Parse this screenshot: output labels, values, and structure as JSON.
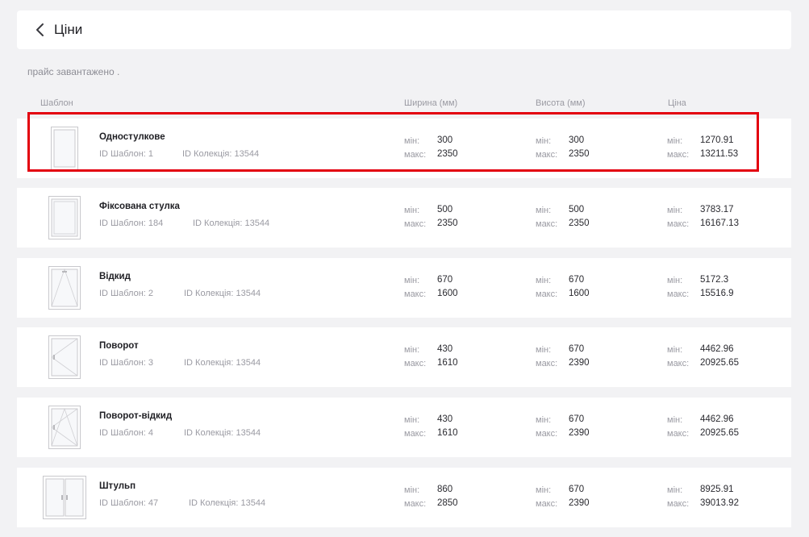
{
  "header": {
    "title": "Ціни"
  },
  "status_text": "прайс завантажено .",
  "columns": {
    "template": "Шаблон",
    "width": "Ширина (мм)",
    "height": "Висота (мм)",
    "price": "Ціна"
  },
  "labels": {
    "min": "мін:",
    "max": "макс:"
  },
  "rows": [
    {
      "name": "Одностулкове",
      "template_id": "ID Шаблон: 1",
      "collection_id": "ID Колекція: 13544",
      "width_min": "300",
      "width_max": "2350",
      "height_min": "300",
      "height_max": "2350",
      "price_min": "1270.91",
      "price_max": "13211.53",
      "icon": "single-sash-window-icon"
    },
    {
      "name": "Фіксована стулка",
      "template_id": "ID Шаблон: 184",
      "collection_id": "ID Колекція: 13544",
      "width_min": "500",
      "width_max": "2350",
      "height_min": "500",
      "height_max": "2350",
      "price_min": "3783.17",
      "price_max": "16167.13",
      "icon": "fixed-sash-window-icon"
    },
    {
      "name": "Відкид",
      "template_id": "ID Шаблон: 2",
      "collection_id": "ID Колекція: 13544",
      "width_min": "670",
      "width_max": "1600",
      "height_min": "670",
      "height_max": "1600",
      "price_min": "5172.3",
      "price_max": "15516.9",
      "icon": "tilt-window-icon"
    },
    {
      "name": "Поворот",
      "template_id": "ID Шаблон: 3",
      "collection_id": "ID Колекція: 13544",
      "width_min": "430",
      "width_max": "1610",
      "height_min": "670",
      "height_max": "2390",
      "price_min": "4462.96",
      "price_max": "20925.65",
      "icon": "turn-window-icon"
    },
    {
      "name": "Поворот-відкид",
      "template_id": "ID Шаблон: 4",
      "collection_id": "ID Колекція: 13544",
      "width_min": "430",
      "width_max": "1610",
      "height_min": "670",
      "height_max": "2390",
      "price_min": "4462.96",
      "price_max": "20925.65",
      "icon": "tilt-turn-window-icon"
    },
    {
      "name": "Штульп",
      "template_id": "ID Шаблон: 47",
      "collection_id": "ID Колекція: 13544",
      "width_min": "860",
      "width_max": "2850",
      "height_min": "670",
      "height_max": "2390",
      "price_min": "8925.91",
      "price_max": "39013.92",
      "icon": "double-sash-window-icon"
    }
  ],
  "colors": {
    "background": "#f2f2f4",
    "card": "#ffffff",
    "highlight": "#e3000f",
    "muted_text": "#9a9aa2"
  }
}
